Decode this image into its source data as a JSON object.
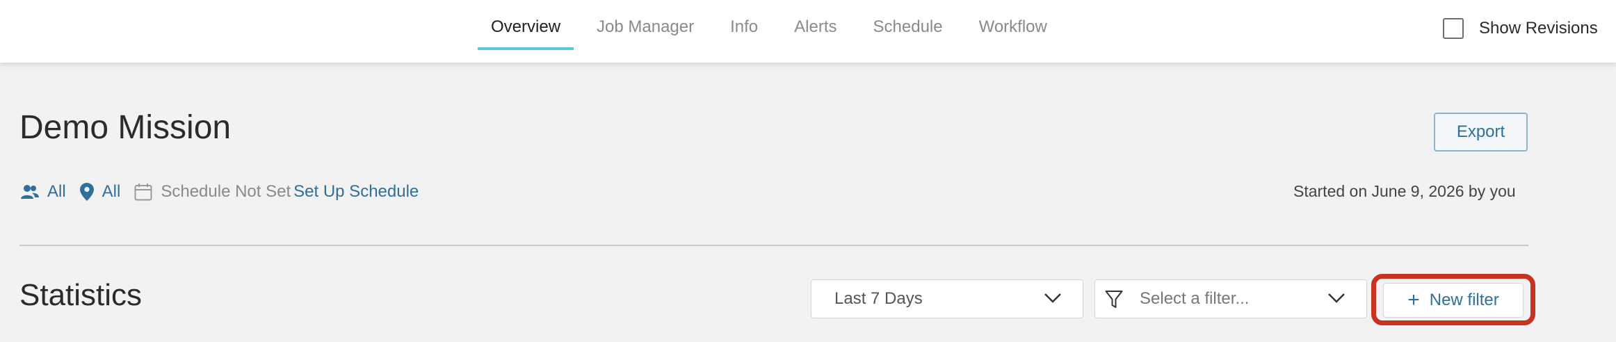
{
  "tabs": [
    {
      "label": "Overview",
      "active": true
    },
    {
      "label": "Job Manager"
    },
    {
      "label": "Info"
    },
    {
      "label": "Alerts"
    },
    {
      "label": "Schedule"
    },
    {
      "label": "Workflow"
    }
  ],
  "revisions": {
    "label": "Show Revisions",
    "checked": false
  },
  "mission": {
    "title": "Demo Mission",
    "export_label": "Export",
    "users_label": "All",
    "locations_label": "All",
    "schedule_status": "Schedule Not Set",
    "schedule_link": "Set Up Schedule",
    "started_text": "Started on June 9, 2026 by you"
  },
  "statistics": {
    "title": "Statistics",
    "range_value": "Last 7 Days",
    "filter_placeholder": "Select a filter...",
    "new_filter_label": "New filter"
  },
  "icons": {
    "users": "users-icon",
    "location": "location-pin-icon",
    "calendar": "calendar-icon",
    "funnel": "funnel-icon",
    "chevron": "chevron-down-icon",
    "plus": "plus-icon"
  },
  "colors": {
    "accent": "#2f6f9a",
    "active_tab_underline": "#5cc8e0",
    "highlight_ring": "#c8321f"
  }
}
